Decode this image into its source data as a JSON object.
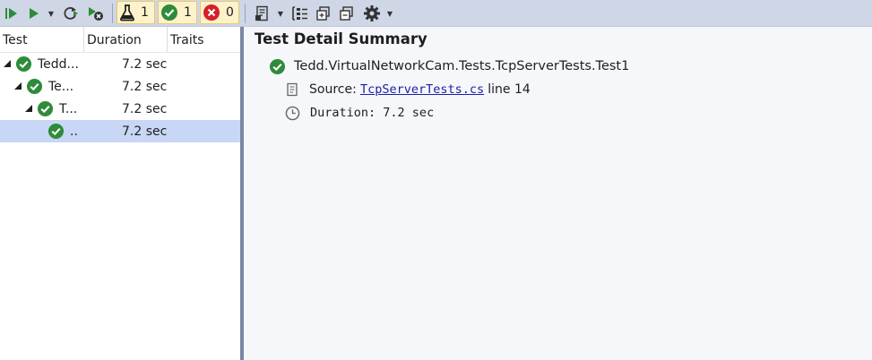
{
  "toolbar": {
    "counters": {
      "total": "1",
      "passed": "1",
      "failed": "0"
    },
    "colors": {
      "background": "#cfd6e5",
      "pass": "#2e8b3a",
      "fail": "#d4202a",
      "counter_bg": "#fdf2c9"
    }
  },
  "tree": {
    "columns": [
      "Test",
      "Duration",
      "Traits"
    ],
    "rows": [
      {
        "name": "Tedd...",
        "duration": "7.2 sec",
        "expanded": true,
        "selected": false
      },
      {
        "name": "Te...",
        "duration": "7.2 sec",
        "expanded": true,
        "selected": false
      },
      {
        "name": "T...",
        "duration": "7.2 sec",
        "expanded": true,
        "selected": false
      },
      {
        "name": "..",
        "duration": "7.2 sec",
        "expanded": false,
        "selected": true
      }
    ]
  },
  "detail": {
    "title": "Test Detail Summary",
    "test_name": "Tedd.VirtualNetworkCam.Tests.TcpServerTests.Test1",
    "source_label": "Source:",
    "source_file": "TcpServerTests.cs",
    "source_line": "line 14",
    "duration_label": "Duration:",
    "duration_value": "7.2 sec"
  }
}
